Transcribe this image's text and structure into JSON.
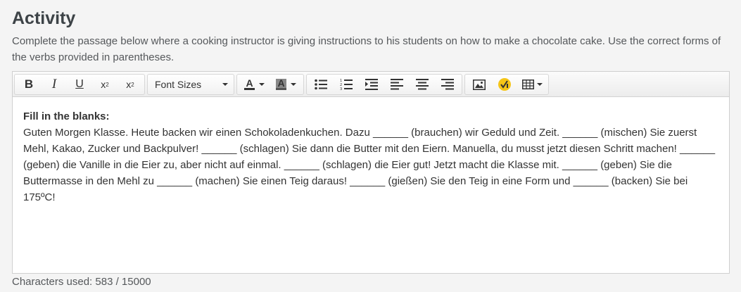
{
  "activity": {
    "title": "Activity",
    "instructions": "Complete the passage below where a cooking instructor is giving instructions to his students on how to make a chocolate cake. Use the correct forms of the verbs provided in parentheses."
  },
  "toolbar": {
    "bold": "B",
    "italic": "I",
    "underline": "U",
    "superscript": "x",
    "superscript_mark": "2",
    "subscript": "x",
    "subscript_mark": "2",
    "font_sizes": "Font Sizes",
    "text_color": "A",
    "background_color": "A",
    "icons": {
      "bullet_list": "bullet-list-icon",
      "numbered_list": "numbered-list-icon",
      "indent": "indent-icon",
      "align_left": "align-left-icon",
      "align_center": "align-center-icon",
      "align_right": "align-right-icon",
      "image": "image-icon",
      "math": "math-formula-icon",
      "table": "table-icon"
    },
    "math_accent": "#f5c518"
  },
  "editor": {
    "label": "Fill in the blanks:",
    "text": "Guten Morgen Klasse. Heute backen wir einen Schokoladenkuchen. Dazu ______ (brauchen) wir Geduld und Zeit. ______ (mischen) Sie zuerst Mehl, Kakao, Zucker und Backpulver! ______ (schlagen) Sie dann die Butter mit den Eiern. Manuella, du musst jetzt diesen Schritt machen! ______ (geben) die Vanille in die Eier zu, aber nicht auf einmal. ______ (schlagen) die Eier gut! Jetzt macht die Klasse mit. ______ (geben) Sie die Buttermasse in den Mehl zu ______ (machen) Sie einen Teig daraus! ______ (gießen) Sie den Teig in eine Form und ______ (backen) Sie bei 175ºC!"
  },
  "footer": {
    "characters_used": "Characters used: 583 / 15000"
  }
}
